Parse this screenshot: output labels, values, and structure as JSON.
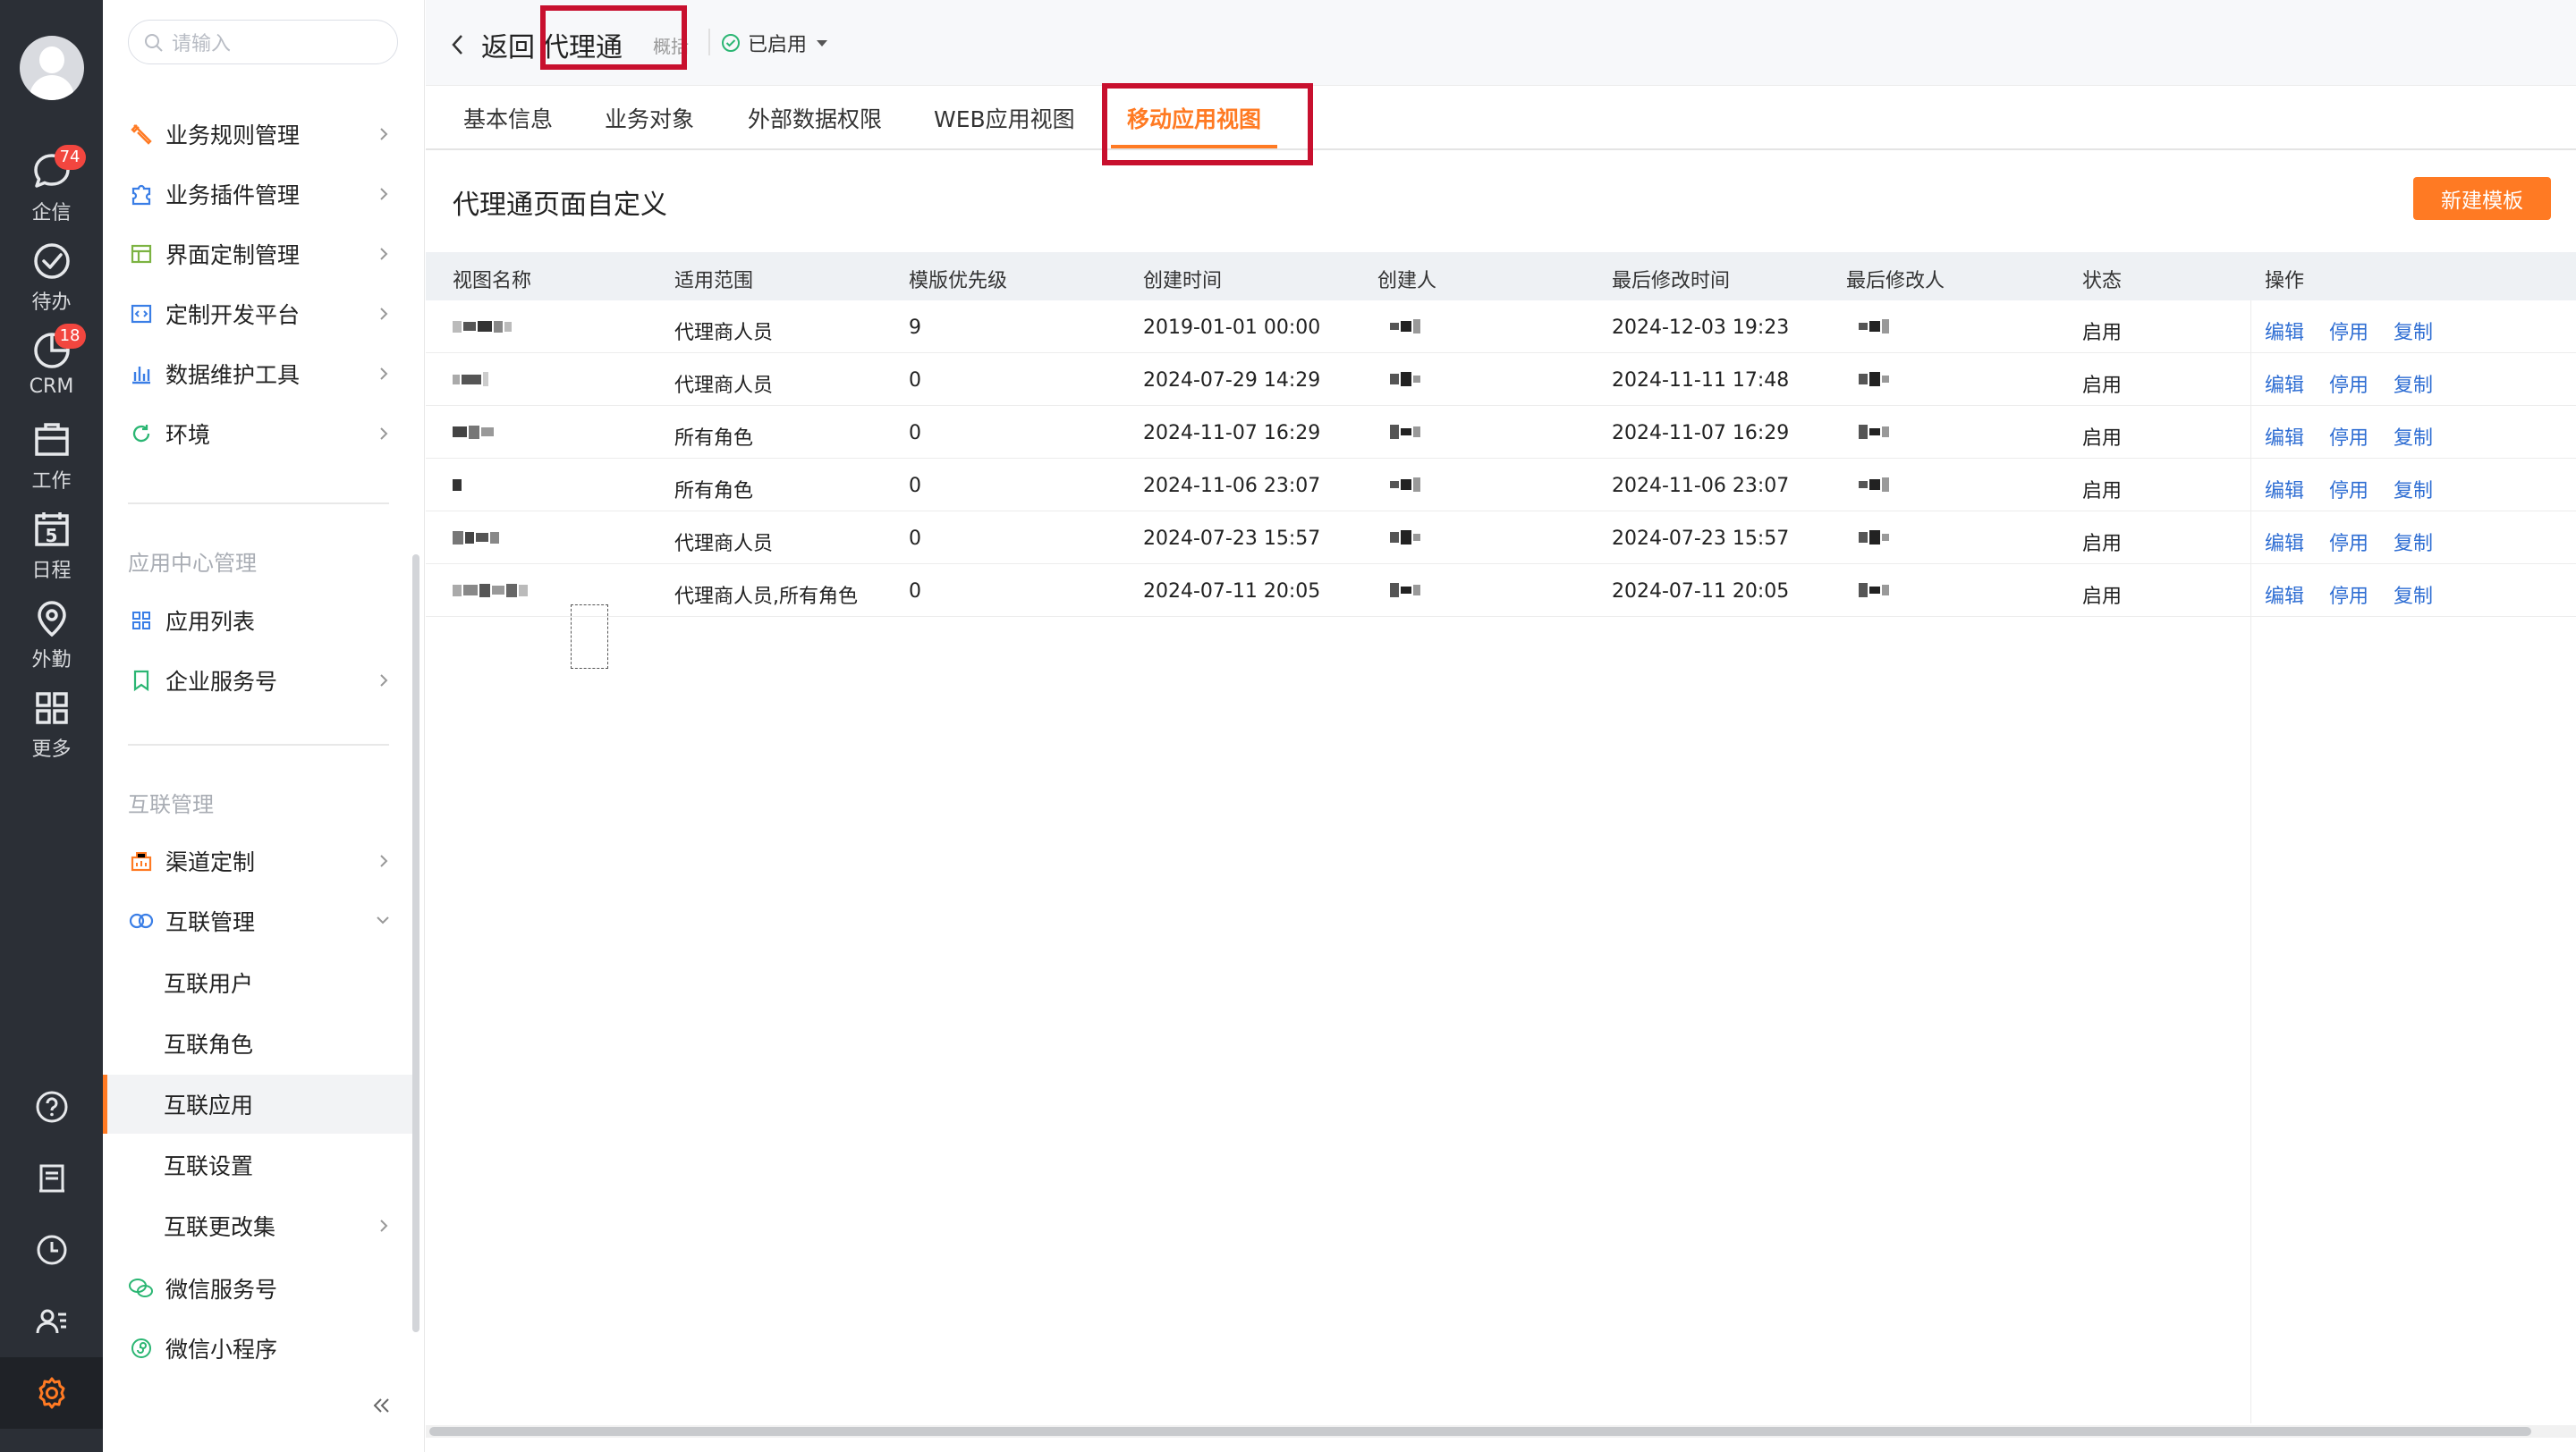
{
  "rail": {
    "items": [
      {
        "label": "企信",
        "icon": "chat-icon",
        "badge": "74"
      },
      {
        "label": "待办",
        "icon": "check-circle-icon",
        "badge": ""
      },
      {
        "label": "CRM",
        "icon": "crm-icon",
        "badge": "18"
      },
      {
        "label": "工作",
        "icon": "briefcase-icon",
        "badge": ""
      },
      {
        "label": "日程",
        "icon": "calendar-icon",
        "badge": "",
        "day": "5"
      },
      {
        "label": "外勤",
        "icon": "location-pin-icon",
        "badge": ""
      },
      {
        "label": "更多",
        "icon": "grid-icon",
        "badge": ""
      }
    ],
    "bottom": [
      "help-icon",
      "notebook-icon",
      "clock-icon",
      "contacts-icon",
      "settings-gear-icon"
    ]
  },
  "nav": {
    "search_placeholder": "请输入",
    "items": [
      {
        "label": "业务规则管理",
        "icon": "wrench-icon",
        "chevron": "right"
      },
      {
        "label": "业务插件管理",
        "icon": "puzzle-icon",
        "chevron": "right"
      },
      {
        "label": "界面定制管理",
        "icon": "layout-icon",
        "chevron": "right"
      },
      {
        "label": "定制开发平台",
        "icon": "code-icon",
        "chevron": "right"
      },
      {
        "label": "数据维护工具",
        "icon": "bar-chart-icon",
        "chevron": "right"
      },
      {
        "label": "环境",
        "icon": "refresh-icon",
        "chevron": "right"
      }
    ],
    "group_app_center": "应用中心管理",
    "app_center_items": [
      {
        "label": "应用列表",
        "icon": "app-grid-icon",
        "chevron": ""
      },
      {
        "label": "企业服务号",
        "icon": "bookmark-icon",
        "chevron": "right"
      }
    ],
    "group_interconnect": "互联管理",
    "interconnect_items": [
      {
        "label": "渠道定制",
        "icon": "channel-icon",
        "chevron": "right"
      },
      {
        "label": "互联管理",
        "icon": "link-rings-icon",
        "chevron": "down"
      }
    ],
    "sub_items": [
      {
        "label": "互联用户",
        "chevron": ""
      },
      {
        "label": "互联角色",
        "chevron": ""
      },
      {
        "label": "互联应用",
        "chevron": "",
        "selected": true
      },
      {
        "label": "互联设置",
        "chevron": ""
      },
      {
        "label": "互联更改集",
        "chevron": "right"
      }
    ],
    "tail_items": [
      {
        "label": "微信服务号",
        "icon": "wechat-icon"
      },
      {
        "label": "微信小程序",
        "icon": "mini-program-icon"
      }
    ]
  },
  "header": {
    "back_label": "返回",
    "app_name": "代理通",
    "app_name_suffix": "概括",
    "status_label": "已启用"
  },
  "tabs": [
    "基本信息",
    "业务对象",
    "外部数据权限",
    "WEB应用视图",
    "移动应用视图"
  ],
  "active_tab": 4,
  "page": {
    "title": "代理通页面自定义",
    "new_button": "新建模板"
  },
  "table": {
    "columns": [
      "视图名称",
      "适用范围",
      "模版优先级",
      "创建时间",
      "创建人",
      "最后修改时间",
      "最后修改人",
      "状态",
      "操作"
    ],
    "rows": [
      {
        "scope": "代理商人员",
        "priority": "9",
        "created": "2019-01-01 00:00",
        "modified": "2024-12-03 19:23",
        "status": "启用"
      },
      {
        "scope": "代理商人员",
        "priority": "0",
        "created": "2024-07-29 14:29",
        "modified": "2024-11-11 17:48",
        "status": "启用"
      },
      {
        "scope": "所有角色",
        "priority": "0",
        "created": "2024-11-07 16:29",
        "modified": "2024-11-07 16:29",
        "status": "启用"
      },
      {
        "scope": "所有角色",
        "priority": "0",
        "created": "2024-11-06 23:07",
        "modified": "2024-11-06 23:07",
        "status": "启用"
      },
      {
        "scope": "代理商人员",
        "priority": "0",
        "created": "2024-07-23 15:57",
        "modified": "2024-07-23 15:57",
        "status": "启用"
      },
      {
        "scope": "代理商人员,所有角色",
        "priority": "0",
        "created": "2024-07-11 20:05",
        "modified": "2024-07-11 20:05",
        "status": "启用"
      }
    ],
    "actions": [
      "编辑",
      "停用",
      "复制"
    ]
  },
  "colors": {
    "accent": "#ff7a23",
    "link": "#2f6ed3",
    "highlight_box": "#c8102e",
    "rail_bg": "#2b2f36",
    "badge": "#f2463f"
  }
}
